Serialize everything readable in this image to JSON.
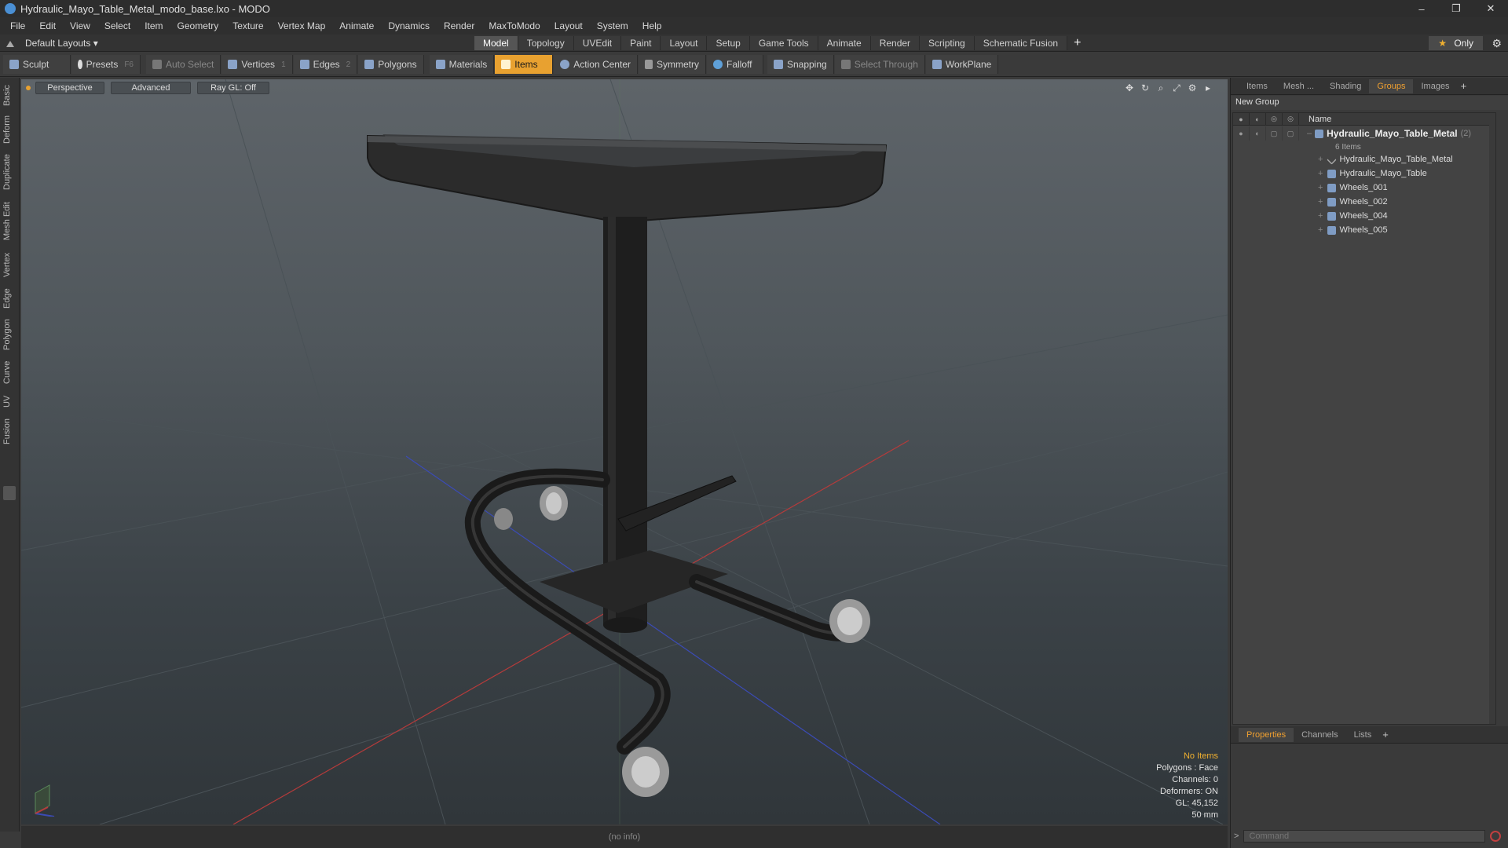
{
  "window": {
    "title": "Hydraulic_Mayo_Table_Metal_modo_base.lxo - MODO",
    "buttons": [
      "–",
      "❐",
      "✕"
    ]
  },
  "menu": [
    "File",
    "Edit",
    "View",
    "Select",
    "Item",
    "Geometry",
    "Texture",
    "Vertex Map",
    "Animate",
    "Dynamics",
    "Render",
    "MaxToModo",
    "Layout",
    "System",
    "Help"
  ],
  "layoutbar": {
    "layouts_label": "Default Layouts ▾",
    "tabs": [
      "Model",
      "Topology",
      "UVEdit",
      "Paint",
      "Layout",
      "Setup",
      "Game Tools",
      "Animate",
      "Render",
      "Scripting",
      "Schematic Fusion"
    ],
    "active_tab": "Model",
    "only_label": "Only"
  },
  "toolbar": {
    "sculpt": "Sculpt",
    "presets": "Presets",
    "presets_key": "F6",
    "auto_select": "Auto Select",
    "vertices": "Vertices",
    "vertices_key": "1",
    "edges": "Edges",
    "edges_key": "2",
    "polygons": "Polygons",
    "materials": "Materials",
    "items": "Items",
    "action_center": "Action Center",
    "symmetry": "Symmetry",
    "falloff": "Falloff",
    "snapping": "Snapping",
    "select_through": "Select Through",
    "workplane": "WorkPlane"
  },
  "leftstrip": [
    "Basic",
    "Deform",
    "Duplicate",
    "Mesh Edit",
    "Vertex",
    "Edge",
    "Polygon",
    "Curve",
    "UV",
    "Fusion"
  ],
  "viewport": {
    "view_mode": "Perspective",
    "shading": "Advanced",
    "raygl": "Ray GL: Off",
    "info": {
      "selection": "No Items",
      "polygons": "Polygons : Face",
      "channels": "Channels: 0",
      "deformers": "Deformers: ON",
      "gl": "GL: 45,152",
      "focal": "50 mm"
    }
  },
  "status": "(no info)",
  "rightpanel": {
    "tabs": [
      "Items",
      "Mesh ...",
      "Shading",
      "Groups",
      "Images"
    ],
    "active_tab": "Groups",
    "new_group": "New Group",
    "column_name": "Name",
    "group": {
      "name": "Hydraulic_Mayo_Table_Metal",
      "count": "(2)",
      "items_label": "6 Items",
      "children": [
        "Hydraulic_Mayo_Table_Metal",
        "Hydraulic_Mayo_Table",
        "Wheels_001",
        "Wheels_002",
        "Wheels_004",
        "Wheels_005"
      ]
    },
    "bottom_tabs": [
      "Properties",
      "Channels",
      "Lists"
    ],
    "bottom_active": "Properties",
    "command_placeholder": "Command"
  },
  "colors": {
    "accent": "#e8a130",
    "viewport_top": "#5e6469",
    "viewport_bottom": "#30363a"
  }
}
